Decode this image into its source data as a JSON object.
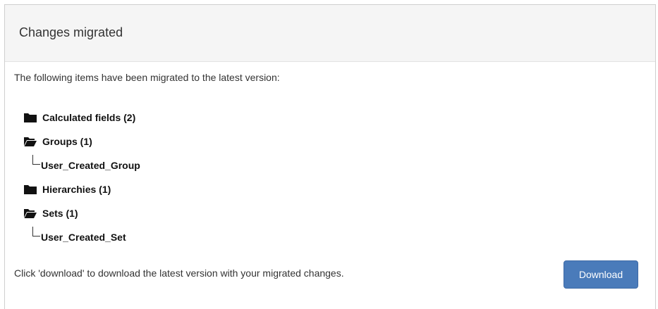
{
  "dialog": {
    "title": "Changes migrated",
    "intro": "The following items have been migrated to the latest version:",
    "tree": [
      {
        "label": "Calculated fields (2)",
        "icon": "folder-closed-icon",
        "children": []
      },
      {
        "label": "Groups (1)",
        "icon": "folder-open-icon",
        "children": [
          "User_Created_Group"
        ]
      },
      {
        "label": "Hierarchies (1)",
        "icon": "folder-closed-icon",
        "children": []
      },
      {
        "label": "Sets (1)",
        "icon": "folder-open-icon",
        "children": [
          "User_Created_Set"
        ]
      }
    ],
    "footer_text": "Click 'download' to download the latest version with your migrated changes.",
    "download_label": "Download"
  },
  "colors": {
    "header_bg": "#f5f5f5",
    "button_bg": "#4a7bba",
    "text": "#333333"
  }
}
